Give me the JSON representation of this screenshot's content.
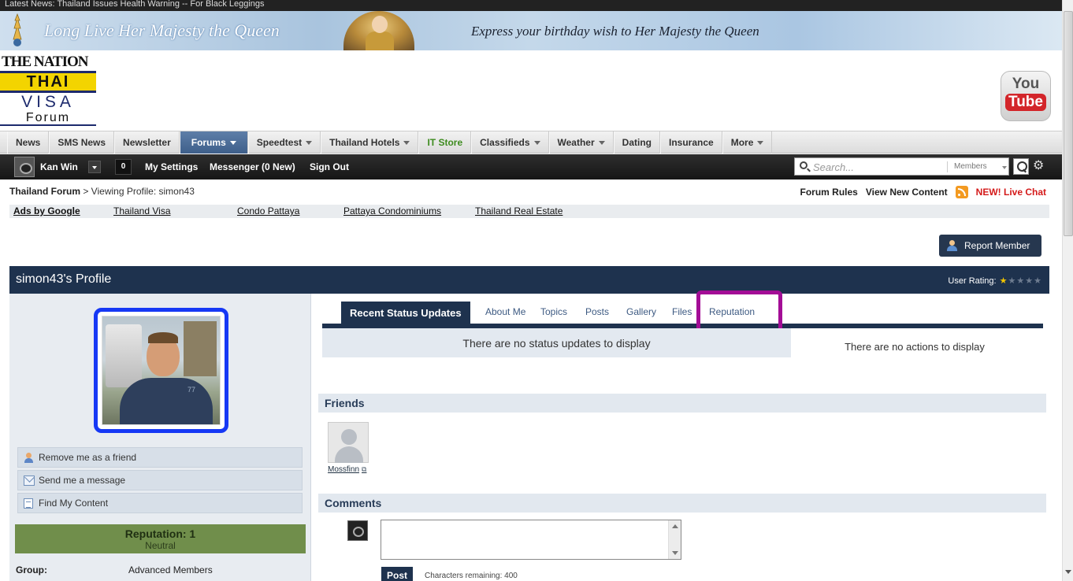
{
  "ticker": {
    "text": "Latest News:  Thailand Issues Health Warning -- For Black Leggings"
  },
  "banner": {
    "long_live": "Long Live Her Majesty the Queen",
    "wish": "Express your birthday wish to Her Majesty the Queen"
  },
  "logo": {
    "line1": "THE NATION",
    "line2": "THAI",
    "line3": "VISA",
    "line4": "Forum"
  },
  "youtube": {
    "you": "You",
    "tube": "Tube"
  },
  "mainnav": {
    "items": [
      {
        "label": "News"
      },
      {
        "label": "SMS News"
      },
      {
        "label": "Newsletter"
      },
      {
        "label": "Forums",
        "active": true
      },
      {
        "label": "Speedtest"
      },
      {
        "label": "Thailand Hotels"
      },
      {
        "label": "IT Store"
      },
      {
        "label": "Classifieds"
      },
      {
        "label": "Weather"
      },
      {
        "label": "Dating"
      },
      {
        "label": "Insurance"
      },
      {
        "label": "More"
      }
    ]
  },
  "userbar": {
    "username": "Kan Win",
    "notifications": "0",
    "my_settings": "My Settings",
    "messenger": "Messenger (0 New)",
    "sign_out": "Sign Out",
    "search_placeholder": "Search...",
    "search_scope": "Members"
  },
  "breadcrumb": {
    "root": "Thailand Forum",
    "current": "> Viewing Profile: simon43"
  },
  "toplinks": {
    "forum_rules": "Forum Rules",
    "view_new": "View New Content",
    "live_chat": "NEW! Live Chat"
  },
  "ads": {
    "label": "Ads by Google",
    "links": [
      "Thailand Visa",
      "Condo Pattaya",
      "Pattaya Condominiums",
      "Thailand Real Estate"
    ]
  },
  "report_button": "Report Member",
  "profile": {
    "title": "simon43's Profile",
    "rating_label": "User Rating:",
    "rating_value": 1,
    "rating_max": 5
  },
  "sidebar": {
    "actions": [
      "Remove me as a friend",
      "Send me a message",
      "Find My Content"
    ],
    "reputation_title": "Reputation: 1",
    "reputation_sub": "Neutral",
    "group_label": "Group:",
    "group_value": "Advanced Members"
  },
  "tabs": [
    "Recent Status Updates",
    "About Me",
    "Topics",
    "Posts",
    "Gallery",
    "Files",
    "Reputation"
  ],
  "status_empty": "There are no status updates to display",
  "actions_empty": "There are no actions to display",
  "friends": {
    "title": "Friends",
    "list": [
      {
        "name": "Mossfinn"
      }
    ]
  },
  "comments": {
    "title": "Comments",
    "post_button": "Post",
    "chars_remaining": "Characters remaining: 400"
  },
  "colors": {
    "nav_active": "#3e5f8a",
    "profile_header": "#1e324e",
    "reputation_bg": "#708e4b",
    "highlight": "#a30d96",
    "photo_border": "#1638f5",
    "live_chat": "#d41a1a"
  }
}
